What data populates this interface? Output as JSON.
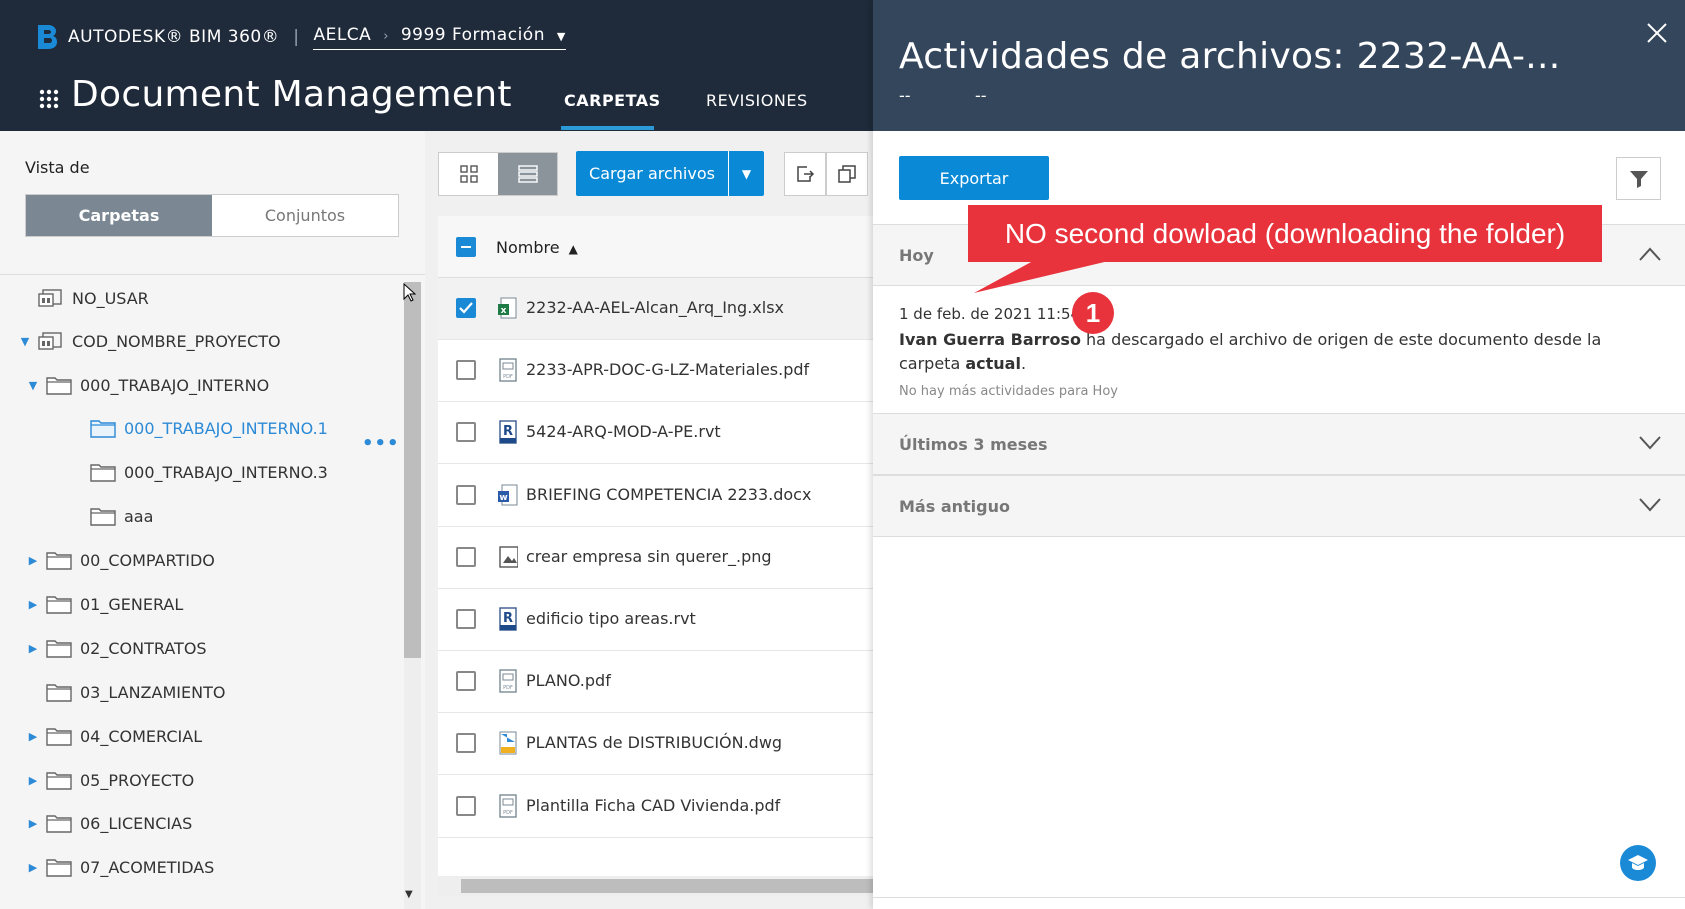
{
  "header": {
    "brand": "AUTODESK® BIM 360®",
    "hub": "AELCA",
    "project": "9999 Formación",
    "app_name": "Document Management",
    "tabs": [
      {
        "label": "CARPETAS",
        "active": true
      },
      {
        "label": "REVISIONES",
        "active": false
      }
    ],
    "colors": {
      "bg": "#1f2a3a",
      "accent": "#2c9ad6"
    }
  },
  "sidebar": {
    "view_label": "Vista de",
    "toggle": [
      "Carpetas",
      "Conjuntos"
    ],
    "tree": [
      {
        "label": "NO_USAR",
        "icon": "project-folder-icon",
        "expand": "",
        "selected": false
      },
      {
        "label": "COD_NOMBRE_PROYECTO",
        "icon": "project-folder-icon",
        "expand": "▼",
        "selected": false
      },
      {
        "label": "000_TRABAJO_INTERNO",
        "icon": "folder-icon",
        "expand": "▼",
        "selected": false
      },
      {
        "label": "000_TRABAJO_INTERNO.1",
        "icon": "folder-icon",
        "expand": "",
        "selected": true
      },
      {
        "label": "000_TRABAJO_INTERNO.3",
        "icon": "folder-icon",
        "expand": "",
        "selected": false
      },
      {
        "label": "aaa",
        "icon": "folder-icon",
        "expand": "",
        "selected": false
      },
      {
        "label": "00_COMPARTIDO",
        "icon": "folder-icon",
        "expand": "▶",
        "selected": false
      },
      {
        "label": "01_GENERAL",
        "icon": "folder-icon",
        "expand": "▶",
        "selected": false
      },
      {
        "label": "02_CONTRATOS",
        "icon": "folder-icon",
        "expand": "▶",
        "selected": false
      },
      {
        "label": "03_LANZAMIENTO",
        "icon": "folder-icon",
        "expand": "",
        "selected": false
      },
      {
        "label": "04_COMERCIAL",
        "icon": "folder-icon",
        "expand": "▶",
        "selected": false
      },
      {
        "label": "05_PROYECTO",
        "icon": "folder-icon",
        "expand": "▶",
        "selected": false
      },
      {
        "label": "06_LICENCIAS",
        "icon": "folder-icon",
        "expand": "▶",
        "selected": false
      },
      {
        "label": "07_ACOMETIDAS",
        "icon": "folder-icon",
        "expand": "▶",
        "selected": false
      }
    ]
  },
  "toolbar": {
    "upload_label": "Cargar archivos"
  },
  "files": {
    "column_name": "Nombre",
    "rows": [
      {
        "name": "2232-AA-AEL-Alcan_Arq_Ing.xlsx",
        "icon": "excel-file-icon",
        "checked": true
      },
      {
        "name": "2233-APR-DOC-G-LZ-Materiales.pdf",
        "icon": "pdf-file-icon",
        "checked": false
      },
      {
        "name": "5424-ARQ-MOD-A-PE.rvt",
        "icon": "revit-file-icon",
        "checked": false
      },
      {
        "name": "BRIEFING COMPETENCIA 2233.docx",
        "icon": "word-file-icon",
        "checked": false
      },
      {
        "name": "crear empresa sin querer_.png",
        "icon": "image-file-icon",
        "checked": false
      },
      {
        "name": "edificio tipo areas.rvt",
        "icon": "revit-file-icon",
        "checked": false
      },
      {
        "name": "PLANO.pdf",
        "icon": "pdf-file-icon",
        "checked": false
      },
      {
        "name": "PLANTAS de DISTRIBUCIÓN.dwg",
        "icon": "dwg-file-icon",
        "checked": false
      },
      {
        "name": "Plantilla Ficha CAD Vivienda.pdf",
        "icon": "pdf-file-icon",
        "checked": false
      }
    ]
  },
  "panel": {
    "title": "Actividades de archivos: 2232-AA-...",
    "sub": [
      "--",
      "--"
    ],
    "export_label": "Exportar",
    "sections": [
      {
        "title": "Hoy",
        "expanded": true
      },
      {
        "title": "Últimos 3 meses",
        "expanded": false
      },
      {
        "title": "Más antiguo",
        "expanded": false
      }
    ],
    "activity": {
      "date": "1 de feb. de 2021 11:54",
      "user": "Ivan Guerra Barroso",
      "text": " ha descargado el archivo de origen de este documento desde la carpeta ",
      "bold_tail": "actual",
      "end": "."
    },
    "no_more": "No hay más actividades para Hoy",
    "colors": {
      "head_bg": "#34465b",
      "button": "#0a8ad6"
    }
  },
  "annotation": {
    "callout_text": "NO second dowload (downloading the folder)",
    "badge": "1",
    "color": "#e8323c"
  }
}
